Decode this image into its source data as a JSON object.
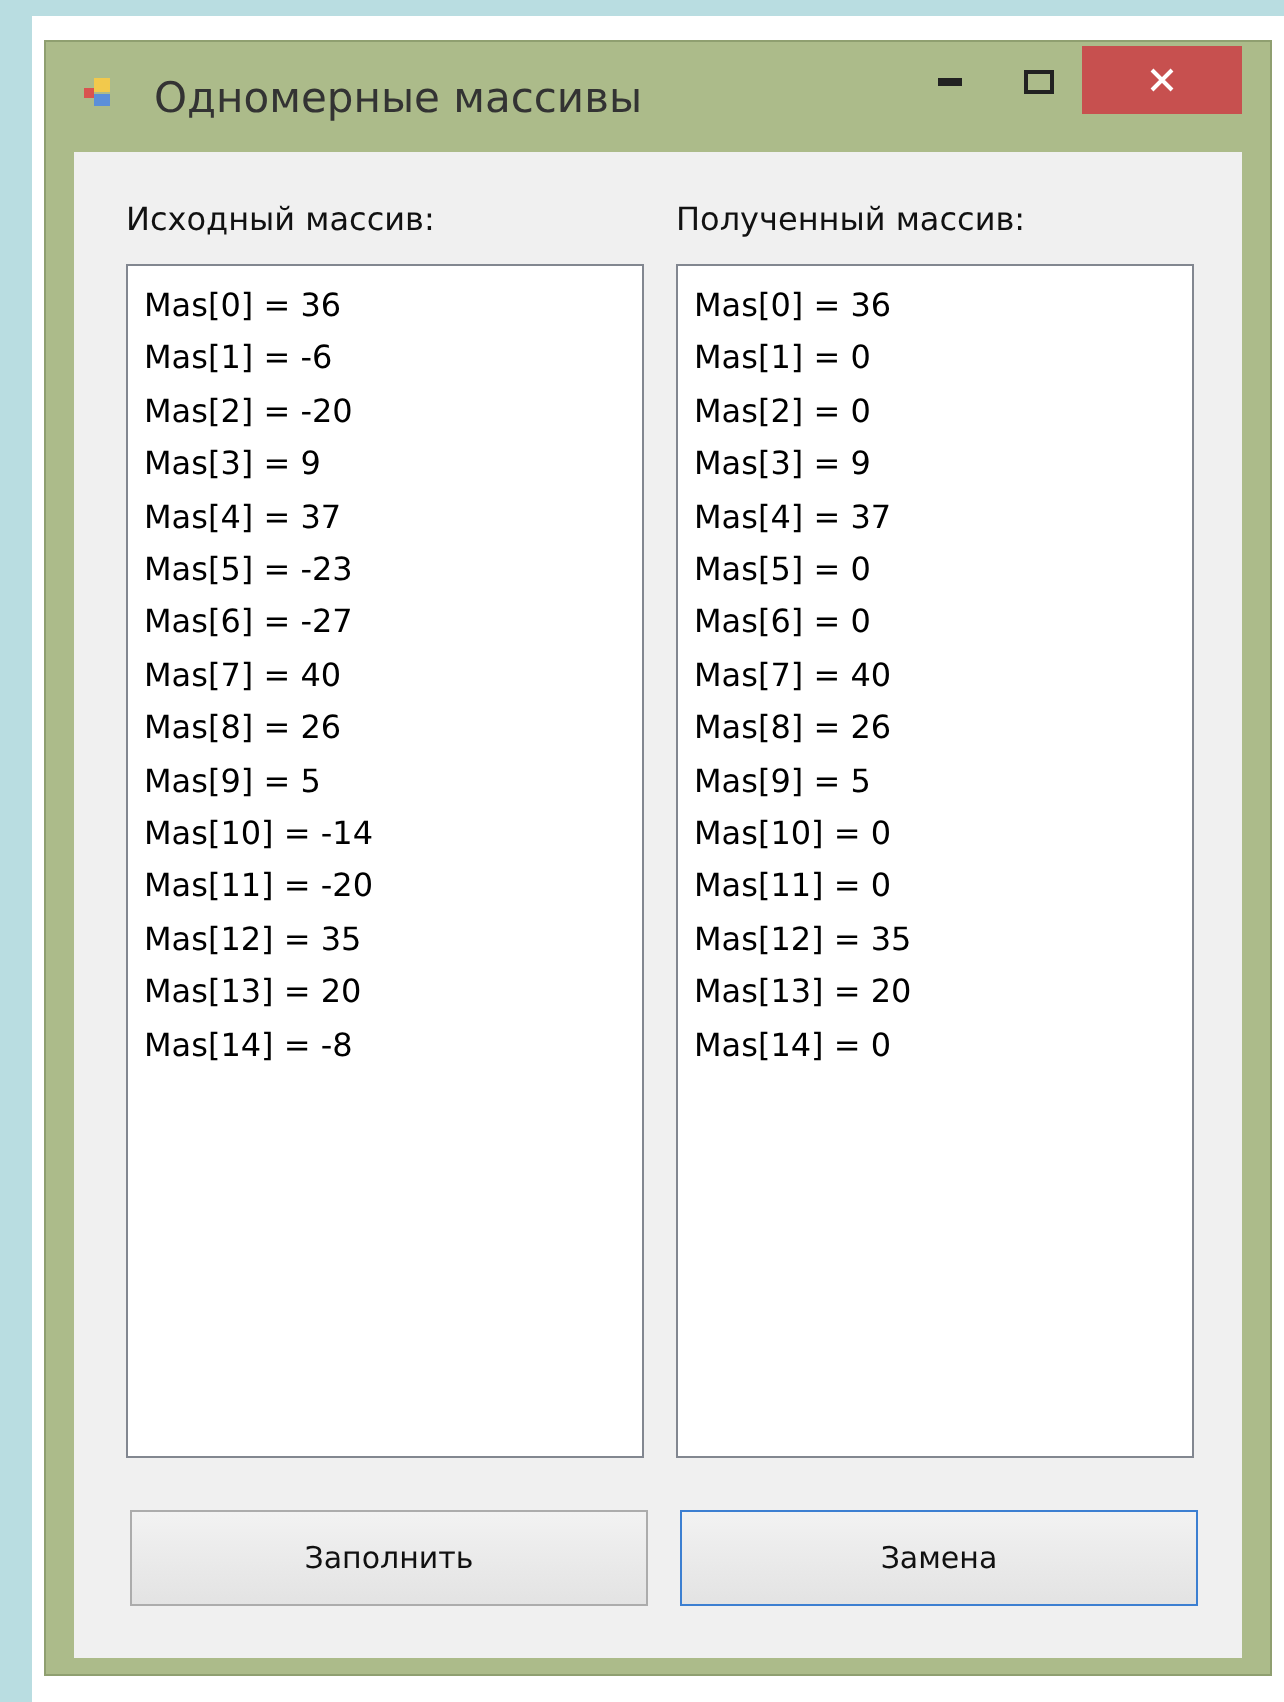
{
  "window": {
    "title": "Одномерные массивы"
  },
  "lists": [
    {
      "label": "Исходный массив:",
      "items": [
        "Mas[0] = 36",
        "Mas[1] = -6",
        "Mas[2] = -20",
        "Mas[3] = 9",
        "Mas[4] = 37",
        "Mas[5] = -23",
        "Mas[6] = -27",
        "Mas[7] = 40",
        "Mas[8] = 26",
        "Mas[9] = 5",
        "Mas[10] = -14",
        "Mas[11] = -20",
        "Mas[12] = 35",
        "Mas[13] = 20",
        "Mas[14] = -8"
      ]
    },
    {
      "label": "Полученный массив:",
      "items": [
        "Mas[0] = 36",
        "Mas[1] = 0",
        "Mas[2] = 0",
        "Mas[3] = 9",
        "Mas[4] = 37",
        "Mas[5] = 0",
        "Mas[6] = 0",
        "Mas[7] = 40",
        "Mas[8] = 26",
        "Mas[9] = 5",
        "Mas[10] = 0",
        "Mas[11] = 0",
        "Mas[12] = 35",
        "Mas[13] = 20",
        "Mas[14] = 0"
      ]
    }
  ],
  "buttons": [
    {
      "label": "Заполнить",
      "focused": false
    },
    {
      "label": "Замена",
      "focused": true
    }
  ]
}
